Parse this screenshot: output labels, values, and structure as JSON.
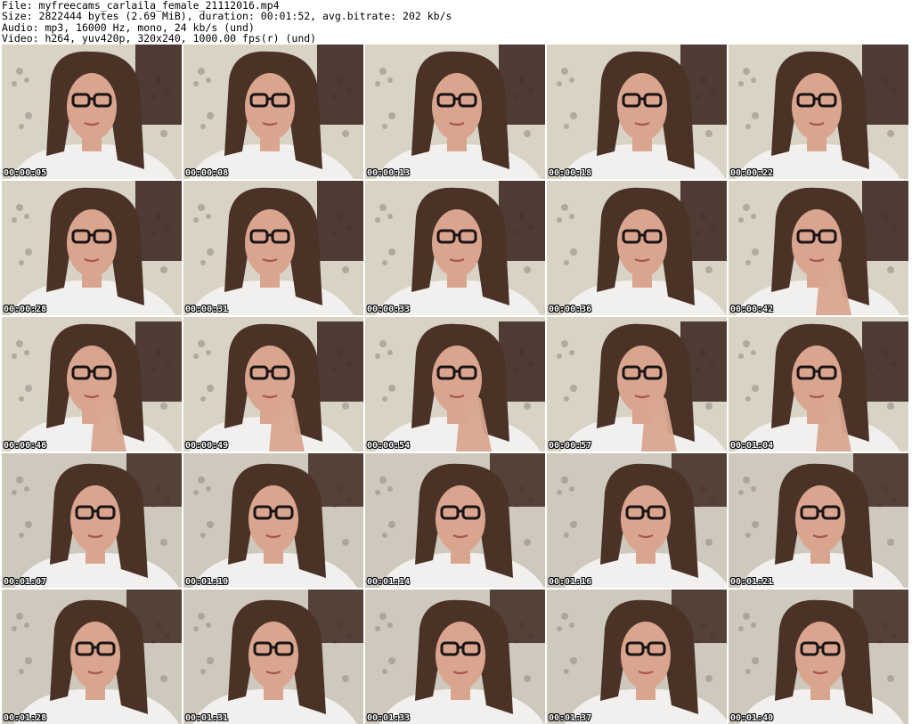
{
  "header": {
    "line1": "File: myfreecams_carlaila_female_21112016.mp4",
    "line2": "Size: 2822444 bytes (2.69 MiB), duration: 00:01:52, avg.bitrate: 202 kb/s",
    "line3": "Audio: mp3, 16000 Hz, mono, 24 kb/s (und)",
    "line4": "Video: h264, yuv420p, 320x240, 1000.00 fps(r) (und)"
  },
  "thumbnails": [
    {
      "timestamp": "00:00:05"
    },
    {
      "timestamp": "00:00:08"
    },
    {
      "timestamp": "00:00:13"
    },
    {
      "timestamp": "00:00:18"
    },
    {
      "timestamp": "00:00:22"
    },
    {
      "timestamp": "00:00:28"
    },
    {
      "timestamp": "00:00:31"
    },
    {
      "timestamp": "00:00:33"
    },
    {
      "timestamp": "00:00:36"
    },
    {
      "timestamp": "00:00:42"
    },
    {
      "timestamp": "00:00:46"
    },
    {
      "timestamp": "00:00:49"
    },
    {
      "timestamp": "00:00:54"
    },
    {
      "timestamp": "00:00:57"
    },
    {
      "timestamp": "00:01:04"
    },
    {
      "timestamp": "00:01:07"
    },
    {
      "timestamp": "00:01:10"
    },
    {
      "timestamp": "00:01:14"
    },
    {
      "timestamp": "00:01:16"
    },
    {
      "timestamp": "00:01:21"
    },
    {
      "timestamp": "00:01:28"
    },
    {
      "timestamp": "00:01:31"
    },
    {
      "timestamp": "00:01:33"
    },
    {
      "timestamp": "00:01:37"
    },
    {
      "timestamp": "00:01:40"
    }
  ],
  "colors": {
    "wallpaper": "#d9d3c5",
    "hair": "#4a3226",
    "skin": "#d9a58f",
    "shirt": "#f2f0ee",
    "glasses": "#1a1414",
    "furniture": "#3e2a22"
  }
}
